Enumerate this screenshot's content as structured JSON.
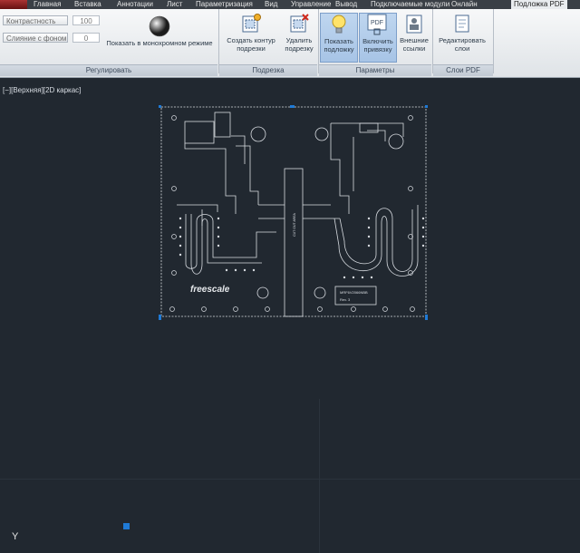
{
  "tabs": [
    {
      "id": "home",
      "label": "Главная"
    },
    {
      "id": "insert",
      "label": "Вставка"
    },
    {
      "id": "annotate",
      "label": "Аннотации"
    },
    {
      "id": "layout",
      "label": "Лист"
    },
    {
      "id": "parametric",
      "label": "Параметризация"
    },
    {
      "id": "view",
      "label": "Вид"
    },
    {
      "id": "manage",
      "label": "Управление"
    },
    {
      "id": "output",
      "label": "Вывод"
    },
    {
      "id": "plugins",
      "label": "Подключаемые модули"
    },
    {
      "id": "online",
      "label": "Онлайн"
    },
    {
      "id": "pdf",
      "label": "Подложка PDF"
    }
  ],
  "adjust": {
    "contrast_label": "Контрастность",
    "contrast_value": "100",
    "fade_label": "Слияние с фоном",
    "fade_value": "0",
    "mono_label": "Показать в монохромном режиме",
    "panel_title": "Регулировать"
  },
  "clip": {
    "create_line1": "Создать контур",
    "create_line2": "подрезки",
    "remove_line1": "Удалить",
    "remove_line2": "подрезку",
    "panel_title": "Подрезка"
  },
  "options": {
    "show_line1": "Показать",
    "show_line2": "подложку",
    "snap_line1": "Включить",
    "snap_line2": "привязку",
    "ext_line1": "Внешние",
    "ext_line2": "ссылки",
    "panel_title": "Параметры"
  },
  "layers": {
    "edit_line1": "Редактировать",
    "edit_line2": "слои",
    "panel_title": "Слои PDF"
  },
  "viewport": {
    "label": "[−][Верхняя][2D каркас]",
    "y_axis": "Y"
  },
  "board": {
    "logo": "freescale",
    "part": "MRF6V2066NBB",
    "rev": "Rev. 3",
    "cut_text": "CUT OUT AREA"
  },
  "colors": {
    "canvas": "#212830",
    "grip": "#1f7ad6",
    "ribbon_selected": "#a7c4e6"
  }
}
